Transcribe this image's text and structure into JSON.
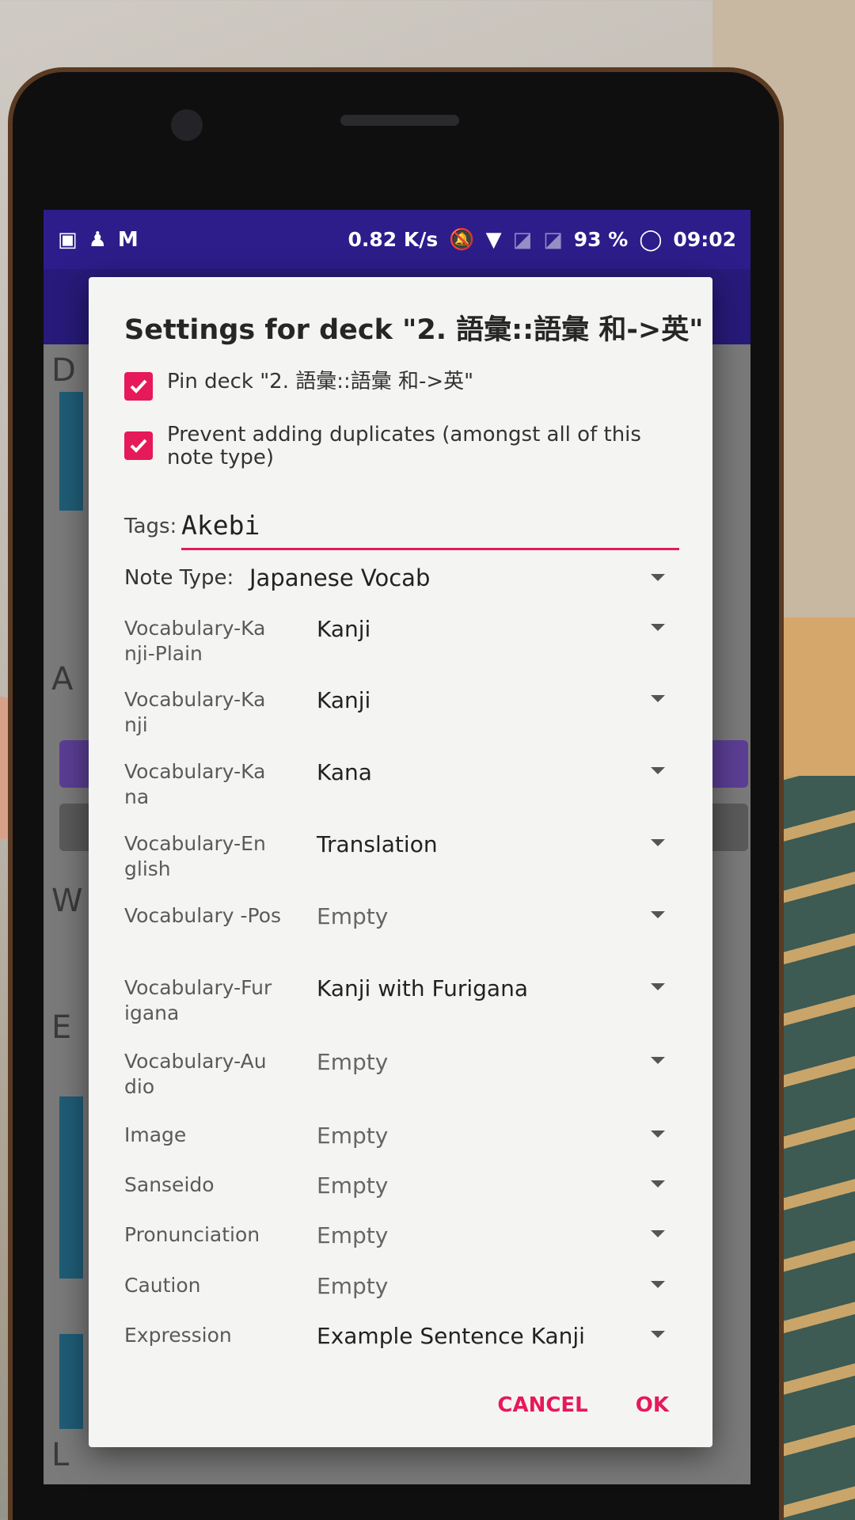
{
  "status_bar": {
    "speed": "0.82 K/s",
    "battery": "93 %",
    "time": "09:02",
    "icons": [
      "notification-icon",
      "account-icon",
      "gmail-icon",
      "mute-icon",
      "wifi-icon",
      "no-sim-icon",
      "no-sim-icon",
      "battery-icon"
    ]
  },
  "dialog": {
    "title": "Settings for deck \"2. 語彙::語彙 和->英\"",
    "pin_deck": {
      "label": "Pin deck \"2. 語彙::語彙 和->英\"",
      "checked": true
    },
    "prevent_duplicates": {
      "label": "Prevent adding duplicates (amongst all of this note type)",
      "checked": true
    },
    "tags": {
      "label": "Tags:",
      "value": "Akebi"
    },
    "note_type": {
      "label": "Note Type:",
      "value": "Japanese Vocab"
    },
    "fields": [
      {
        "label": "Vocabulary-Ka nji-Plain",
        "value": "Kanji"
      },
      {
        "label": "Vocabulary-Ka nji",
        "value": "Kanji"
      },
      {
        "label": "Vocabulary-Ka na",
        "value": "Kana"
      },
      {
        "label": "Vocabulary-En glish",
        "value": "Translation"
      },
      {
        "label": "Vocabulary -Pos",
        "value": "Empty"
      },
      {
        "label": "Vocabulary-Fur igana",
        "value": "Kanji with Furigana"
      },
      {
        "label": "Vocabulary-Au dio",
        "value": "Empty"
      },
      {
        "label": "Image",
        "value": "Empty"
      },
      {
        "label": "Sanseido",
        "value": "Empty"
      },
      {
        "label": "Pronunciation",
        "value": "Empty"
      },
      {
        "label": "Caution",
        "value": "Empty"
      },
      {
        "label": "Expression",
        "value": "Example Sentence Kanji"
      }
    ],
    "cancel_label": "CANCEL",
    "ok_label": "OK"
  },
  "colors": {
    "accent": "#e6195a",
    "statusbar": "#2c1d8a",
    "dialog_bg": "#f4f5f3"
  }
}
